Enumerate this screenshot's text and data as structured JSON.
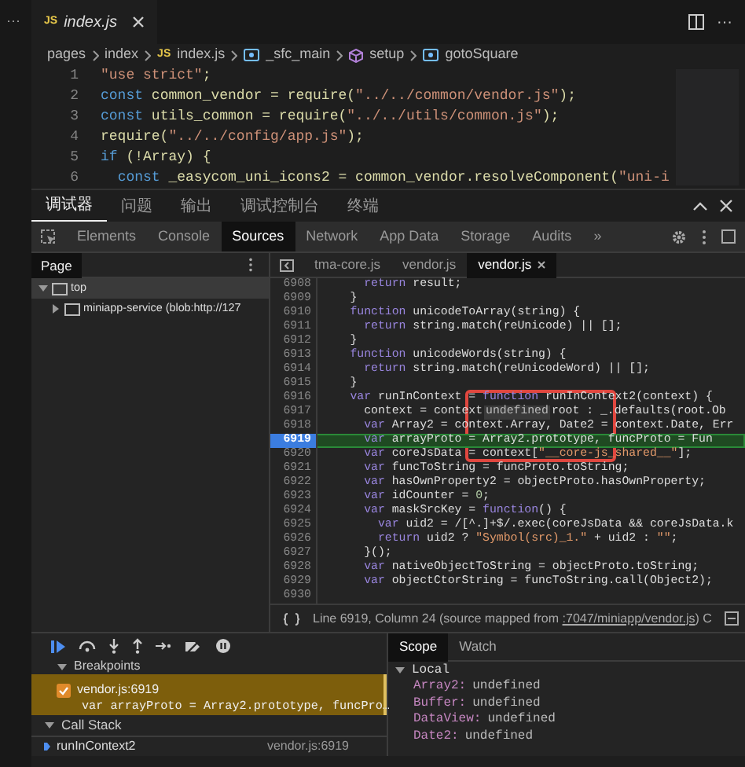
{
  "sidebar": {
    "more": "···"
  },
  "editor": {
    "tabs": [
      {
        "badge": "JS",
        "label": "index.js",
        "selected": true,
        "closable": true
      }
    ],
    "more": "···",
    "breadcrumb": [
      {
        "label": "pages",
        "kind": "folder"
      },
      {
        "label": "index",
        "kind": "folder"
      },
      {
        "label": "index.js",
        "kind": "file",
        "badge": "JS"
      },
      {
        "label": "_sfc_main",
        "kind": "symbol"
      },
      {
        "label": "setup",
        "kind": "method"
      },
      {
        "label": "gotoSquare",
        "kind": "symbol"
      }
    ],
    "lines": [
      {
        "number": "1",
        "text": "\"use strict\";"
      },
      {
        "number": "2",
        "text": "const common_vendor = require(\"../../common/vendor.js\");"
      },
      {
        "number": "3",
        "text": "const utils_common = require(\"../../utils/common.js\");"
      },
      {
        "number": "4",
        "text": "require(\"../../config/app.js\");"
      },
      {
        "number": "5",
        "text": "if (!Array) {"
      },
      {
        "number": "6",
        "text": "  const _easycom_uni_icons2 = common_vendor.resolveComponent(\"uni-i"
      }
    ]
  },
  "panel": {
    "tabs": [
      {
        "label": "调试器",
        "selected": true
      },
      {
        "label": "问题",
        "selected": false
      },
      {
        "label": "输出",
        "selected": false
      },
      {
        "label": "调试控制台",
        "selected": false
      },
      {
        "label": "终端",
        "selected": false
      }
    ]
  },
  "devtools": {
    "tabs": [
      {
        "label": "Elements",
        "selected": false
      },
      {
        "label": "Console",
        "selected": false
      },
      {
        "label": "Sources",
        "selected": true
      },
      {
        "label": "Network",
        "selected": false
      },
      {
        "label": "App Data",
        "selected": false
      },
      {
        "label": "Storage",
        "selected": false
      },
      {
        "label": "Audits",
        "selected": false
      }
    ],
    "more": "»"
  },
  "page_pane": {
    "title": "Page",
    "tree": [
      {
        "label": "top",
        "expanded": true,
        "selected": true,
        "children": [
          {
            "label": "miniapp-service (blob:http://127",
            "expanded": false,
            "selected": false
          }
        ]
      }
    ]
  },
  "source": {
    "tabs": [
      {
        "label": "tma-core.js",
        "selected": false,
        "closable": false
      },
      {
        "label": "vendor.js",
        "selected": false,
        "closable": false
      },
      {
        "label": "vendor.js",
        "selected": true,
        "closable": true
      }
    ],
    "lines": [
      {
        "number": "6908",
        "text": "      return result;",
        "breakpoint": false
      },
      {
        "number": "6909",
        "text": "    }",
        "breakpoint": false
      },
      {
        "number": "6910",
        "text": "    function unicodeToArray(string) {",
        "breakpoint": false
      },
      {
        "number": "6911",
        "text": "      return string.match(reUnicode) || [];",
        "breakpoint": false
      },
      {
        "number": "6912",
        "text": "    }",
        "breakpoint": false
      },
      {
        "number": "6913",
        "text": "    function unicodeWords(string) {",
        "breakpoint": false
      },
      {
        "number": "6914",
        "text": "      return string.match(reUnicodeWord) || [];",
        "breakpoint": false
      },
      {
        "number": "6915",
        "text": "    }",
        "breakpoint": false
      },
      {
        "number": "6916",
        "text": "    var runInContext = function runInContext2(context) {",
        "breakpoint": false
      },
      {
        "number": "6917",
        "text": "      context = context",
        "tooltip": "undefined",
        "rest": "root : _.defaults(root.Ob",
        "breakpoint": false
      },
      {
        "number": "6918",
        "text": "      var Array2 = context.Array, Date2 = context.Date, Err",
        "breakpoint": false
      },
      {
        "number": "6919",
        "text": "      var arrayProto = Array2.prototype, funcProto = Fun",
        "breakpoint": true
      },
      {
        "number": "6920",
        "text": "      var coreJsData = context[\"__core-js_shared__\"];",
        "breakpoint": false
      },
      {
        "number": "6921",
        "text": "      var funcToString = funcProto.toString;",
        "breakpoint": false
      },
      {
        "number": "6922",
        "text": "      var hasOwnProperty2 = objectProto.hasOwnProperty;",
        "breakpoint": false
      },
      {
        "number": "6923",
        "text": "      var idCounter = 0;",
        "breakpoint": false
      },
      {
        "number": "6924",
        "text": "      var maskSrcKey = function() {",
        "breakpoint": false
      },
      {
        "number": "6925",
        "text": "        var uid2 = /[^.]+$/.exec(coreJsData && coreJsData.k",
        "breakpoint": false
      },
      {
        "number": "6926",
        "text": "        return uid2 ? \"Symbol(src)_1.\" + uid2 : \"\";",
        "breakpoint": false
      },
      {
        "number": "6927",
        "text": "      }();",
        "breakpoint": false
      },
      {
        "number": "6928",
        "text": "      var nativeObjectToString = objectProto.toString;",
        "breakpoint": false
      },
      {
        "number": "6929",
        "text": "      var objectCtorString = funcToString.call(Object2);",
        "breakpoint": false
      },
      {
        "number": "6930",
        "breakpoint": false
      }
    ],
    "status": {
      "text": "Line 6919, Column 24 (source mapped from ",
      "link": ":7047/miniapp/vendor.js",
      "tail": ") C"
    }
  },
  "breakpoints": {
    "title": "Breakpoints",
    "expanded": true,
    "items": [
      {
        "file": "vendor.js:6919",
        "code": "var arrayProto = Array2.prototype, funcPro…",
        "checked": true
      }
    ]
  },
  "call_stack": {
    "title": "Call Stack",
    "expanded": true,
    "frames": [
      {
        "name": "runInContext2",
        "location": "vendor.js:6919",
        "selected": true
      }
    ]
  },
  "scope": {
    "tabs": [
      {
        "label": "Scope",
        "selected": true
      },
      {
        "label": "Watch",
        "selected": false
      }
    ],
    "sections": [
      {
        "title": "Local",
        "expanded": true,
        "vars": [
          {
            "name": "Array2:",
            "value": "undefined"
          },
          {
            "name": "Buffer:",
            "value": "undefined"
          },
          {
            "name": "DataView:",
            "value": "undefined"
          },
          {
            "name": "Date2:",
            "value": "undefined"
          }
        ]
      }
    ]
  }
}
